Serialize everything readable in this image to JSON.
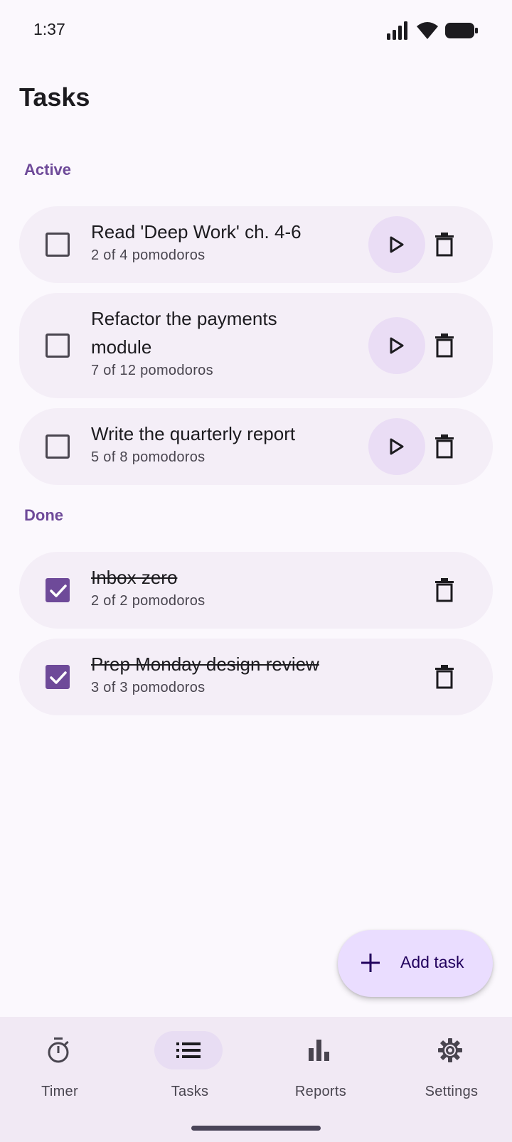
{
  "status_bar": {
    "time": "1:37"
  },
  "header": {
    "title": "Tasks"
  },
  "sections": {
    "active_label": "Active",
    "done_label": "Done"
  },
  "active_tasks": [
    {
      "title": "Read 'Deep Work' ch. 4-6",
      "progress": "2 of 4 pomodoros",
      "checked": false
    },
    {
      "title": "Refactor the payments module",
      "progress": "7 of 12 pomodoros",
      "checked": false
    },
    {
      "title": "Write the quarterly report",
      "progress": "5 of 8 pomodoros",
      "checked": false
    }
  ],
  "done_tasks": [
    {
      "title": "Inbox zero",
      "progress": "2 of 2 pomodoros",
      "checked": true
    },
    {
      "title": "Prep Monday design review",
      "progress": "3 of 3 pomodoros",
      "checked": true
    }
  ],
  "fab": {
    "label": "Add task",
    "icon": "plus-icon"
  },
  "bottom_nav": {
    "items": [
      {
        "label": "Timer",
        "icon": "stopwatch-icon",
        "active": false
      },
      {
        "label": "Tasks",
        "icon": "list-icon",
        "active": true
      },
      {
        "label": "Reports",
        "icon": "bar-chart-icon",
        "active": false
      },
      {
        "label": "Settings",
        "icon": "gear-icon",
        "active": false
      }
    ]
  },
  "colors": {
    "primary": "#6E4A99",
    "card_background": "#F4EEF7",
    "play_button": "#EADDF5",
    "fab_background": "#EADDFF",
    "nav_background": "#F1E9F4",
    "page_background": "#FBF8FD"
  }
}
